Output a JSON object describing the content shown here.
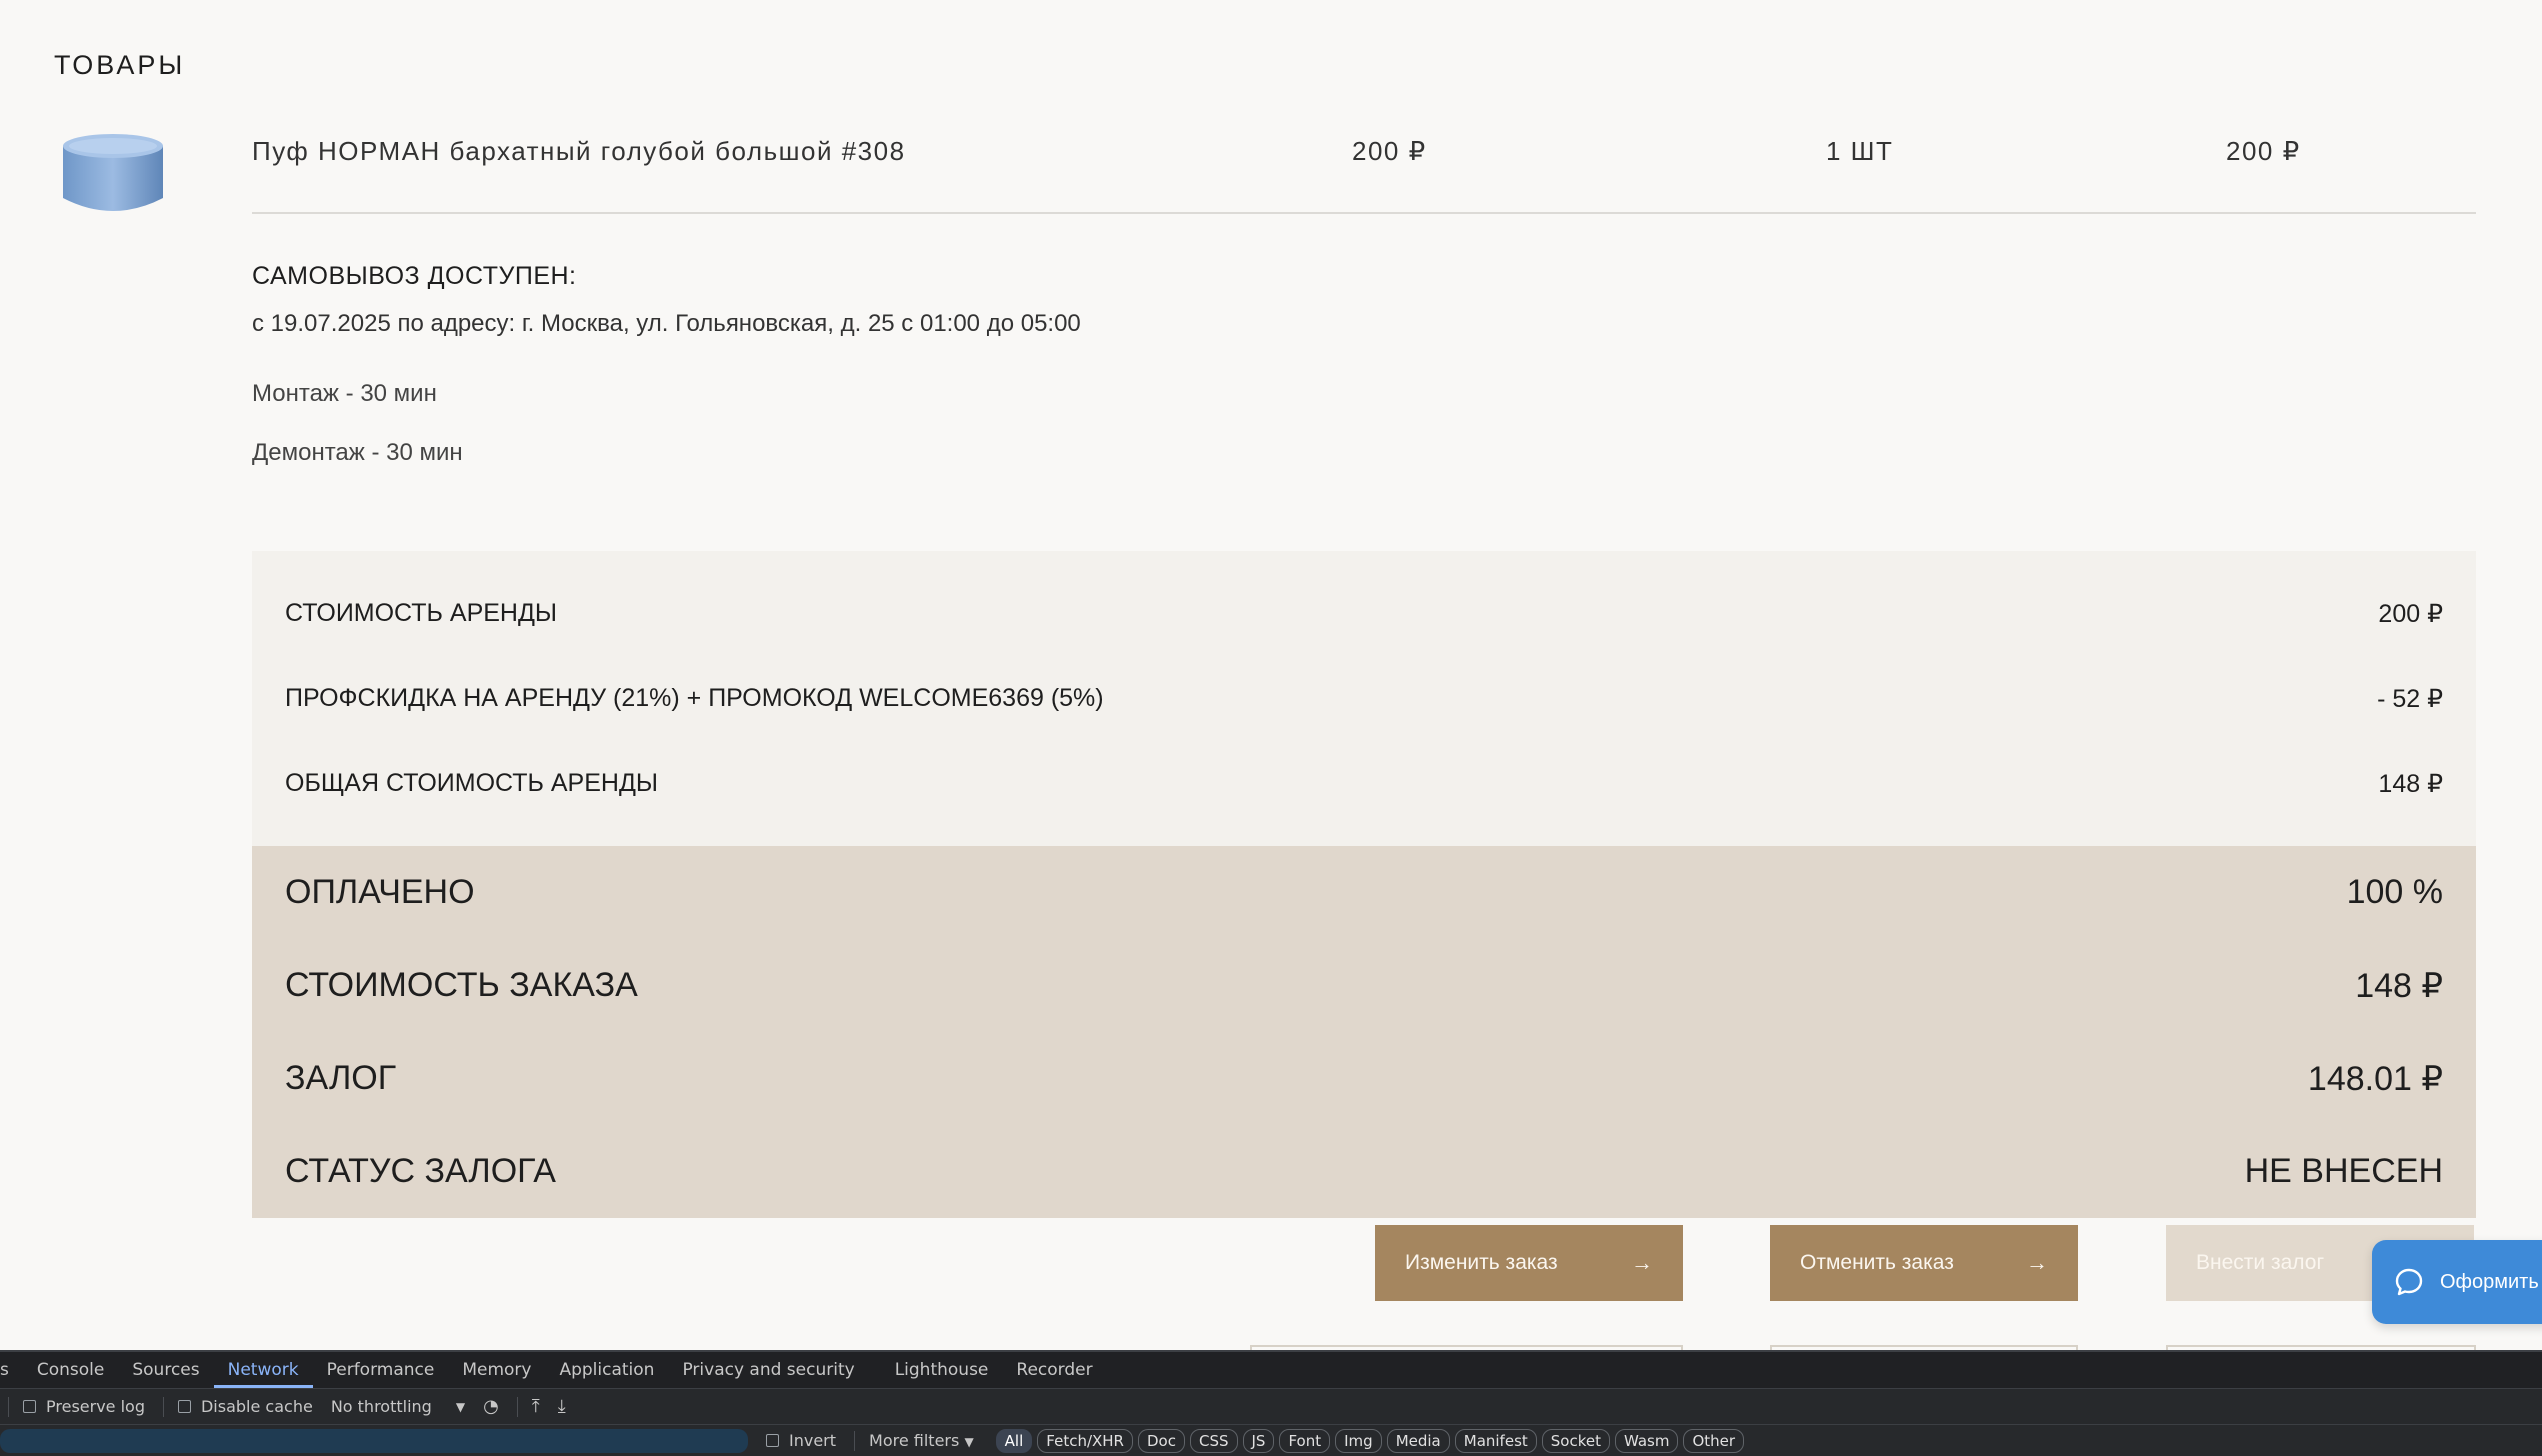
{
  "section_title": "ТОВАРЫ",
  "product": {
    "name": "Пуф НОРМАН бархатный голубой большой #308",
    "price": "200 ₽",
    "qty": "1 ШТ",
    "total": "200 ₽"
  },
  "pickup": {
    "title": "САМОВЫВОЗ ДОСТУПЕН:",
    "text": "с 19.07.2025 по адресу: г. Москва, ул. Гольяновская, д. 25 с 01:00 до 05:00"
  },
  "mount": "Монтаж - 30 мин",
  "unmount": "Демонтаж - 30 мин",
  "summary_light": [
    {
      "label": "СТОИМОСТЬ АРЕНДЫ",
      "value": "200 ₽"
    },
    {
      "label": "ПРОФСКИДКА НА АРЕНДУ (21%) + ПРОМОКОД WELCOME6369 (5%)",
      "value": "- 52 ₽"
    },
    {
      "label": "ОБЩАЯ СТОИМОСТЬ АРЕНДЫ",
      "value": "148 ₽"
    }
  ],
  "summary_dark": [
    {
      "label": "ОПЛАЧЕНО",
      "value": "100 %"
    },
    {
      "label": "СТОИМОСТЬ ЗАКАЗА",
      "value": "148 ₽"
    },
    {
      "label": "ЗАЛОГ",
      "value": "148.01 ₽"
    },
    {
      "label": "СТАТУС ЗАЛОГА",
      "value": "НЕ ВНЕСЕН"
    }
  ],
  "buttons": {
    "change": "Изменить заказ",
    "cancel": "Отменить заказ",
    "deposit": "Внести залог",
    "arrow": "→"
  },
  "chat": {
    "label": "Оформить з"
  },
  "devtools": {
    "tabs": [
      "s",
      "Console",
      "Sources",
      "Network",
      "Performance",
      "Memory",
      "Application",
      "Privacy and security",
      "Lighthouse",
      "Recorder"
    ],
    "active_tab": "Network",
    "preserve_log": "Preserve log",
    "disable_cache": "Disable cache",
    "throttling": "No throttling",
    "invert": "Invert",
    "more_filters": "More filters",
    "filters": [
      "All",
      "Fetch/XHR",
      "Doc",
      "CSS",
      "JS",
      "Font",
      "Img",
      "Media",
      "Manifest",
      "Socket",
      "Wasm",
      "Other"
    ]
  },
  "colors": {
    "accent_brown": "#a5865f",
    "disabled_beige": "#e2d9cd",
    "summary_light": "#f3f1ed",
    "summary_dark": "#e0d7cc",
    "chat_blue": "#3e8ad8"
  }
}
